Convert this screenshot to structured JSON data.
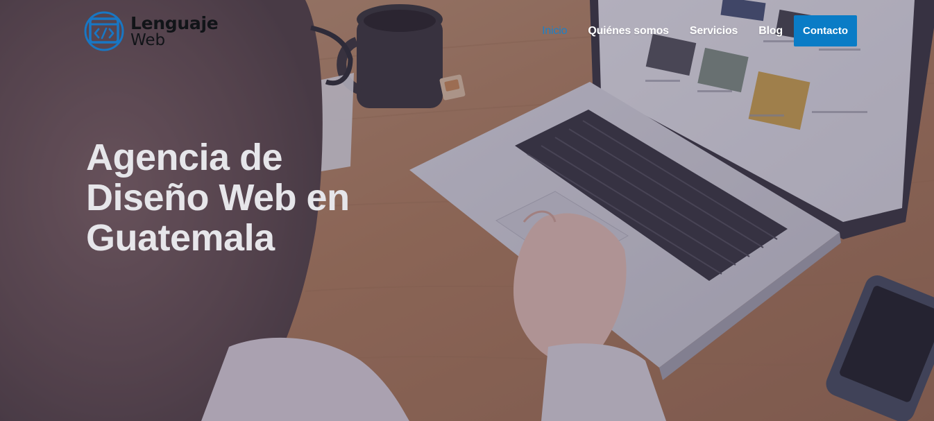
{
  "brand": {
    "name_line1": "Lenguaje",
    "name_line2": "Web",
    "accent_color": "#0a7cc6"
  },
  "nav": {
    "items": [
      {
        "label": "Inicio",
        "active": true
      },
      {
        "label": "Quiénes somos",
        "active": false
      },
      {
        "label": "Servicios",
        "active": false
      },
      {
        "label": "Blog",
        "active": false
      }
    ],
    "cta_label": "Contacto"
  },
  "hero": {
    "title_line1": "Agencia de",
    "title_line2": "Diseño Web en",
    "title_line3": "Guatemala"
  }
}
